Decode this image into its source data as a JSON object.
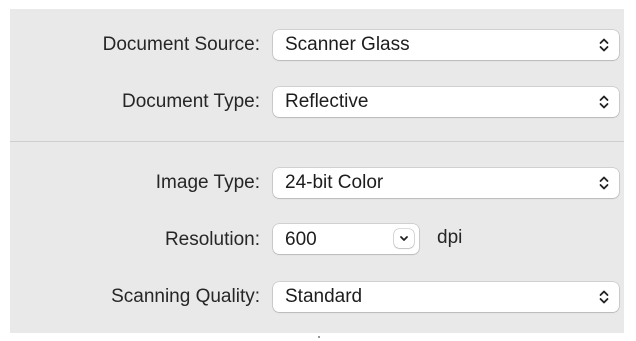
{
  "scan_settings": {
    "document_source": {
      "label": "Document Source:",
      "value": "Scanner Glass",
      "icon": "chevron-updown-icon"
    },
    "document_type": {
      "label": "Document Type:",
      "value": "Reflective",
      "icon": "chevron-updown-icon"
    },
    "image_type": {
      "label": "Image Type:",
      "value": "24-bit Color",
      "icon": "chevron-updown-icon"
    },
    "resolution": {
      "label": "Resolution:",
      "value": "600",
      "unit": "dpi",
      "icon": "chevron-down-icon"
    },
    "scanning_quality": {
      "label": "Scanning Quality:",
      "value": "Standard",
      "icon": "chevron-updown-icon"
    }
  },
  "colors": {
    "panel_background": "#e9e9e9",
    "control_background": "#ffffff",
    "text": "#262626"
  }
}
